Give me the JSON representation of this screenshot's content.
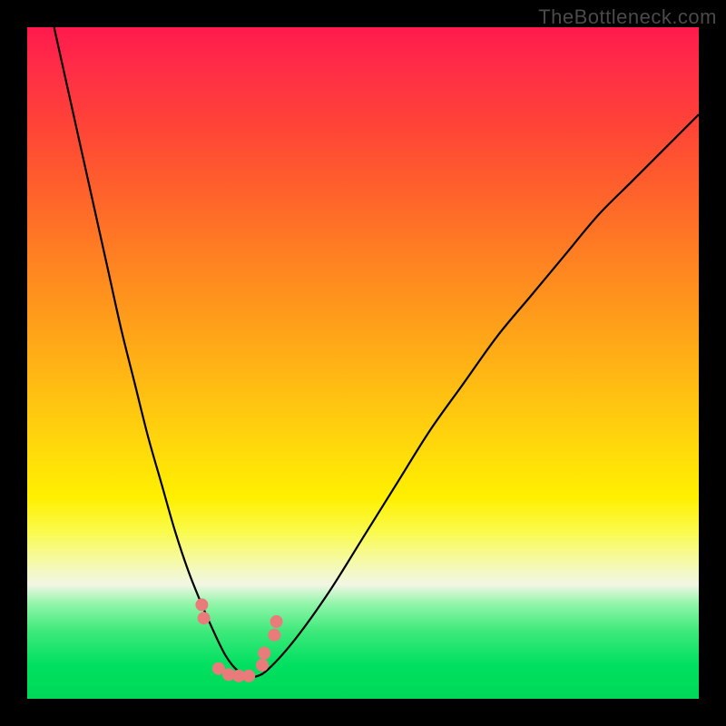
{
  "watermark": "TheBottleneck.com",
  "chart_data": {
    "type": "line",
    "title": "",
    "xlabel": "",
    "ylabel": "",
    "xlim": [
      0,
      100
    ],
    "ylim": [
      0,
      100
    ],
    "grid": false,
    "legend": false,
    "background_gradient": [
      "#ff1a4d",
      "#ffd70c",
      "#fff000",
      "#00d858"
    ],
    "series": [
      {
        "name": "bottleneck-curve",
        "x": [
          4,
          6,
          8,
          10,
          12,
          14,
          16,
          18,
          20,
          22,
          24,
          26,
          28,
          29.5,
          31,
          32.5,
          34,
          36,
          40,
          45,
          50,
          55,
          60,
          65,
          70,
          75,
          80,
          85,
          90,
          95,
          100
        ],
        "y": [
          100,
          91,
          82,
          73,
          64,
          55,
          47,
          39,
          32,
          25,
          19,
          14,
          9.5,
          6.5,
          4.5,
          3.5,
          3.3,
          4.5,
          9,
          16,
          24,
          32,
          40,
          47,
          54,
          60,
          66,
          72,
          77,
          82,
          87
        ]
      }
    ],
    "annotations": {
      "trough_dots_x": [
        26.0,
        26.3,
        28.5,
        30.0,
        31.5,
        33.0,
        35.0,
        35.3,
        36.8,
        37.1
      ],
      "trough_dots_y": [
        14.0,
        12.0,
        4.5,
        3.6,
        3.4,
        3.4,
        5.0,
        6.8,
        9.5,
        11.5
      ]
    }
  }
}
